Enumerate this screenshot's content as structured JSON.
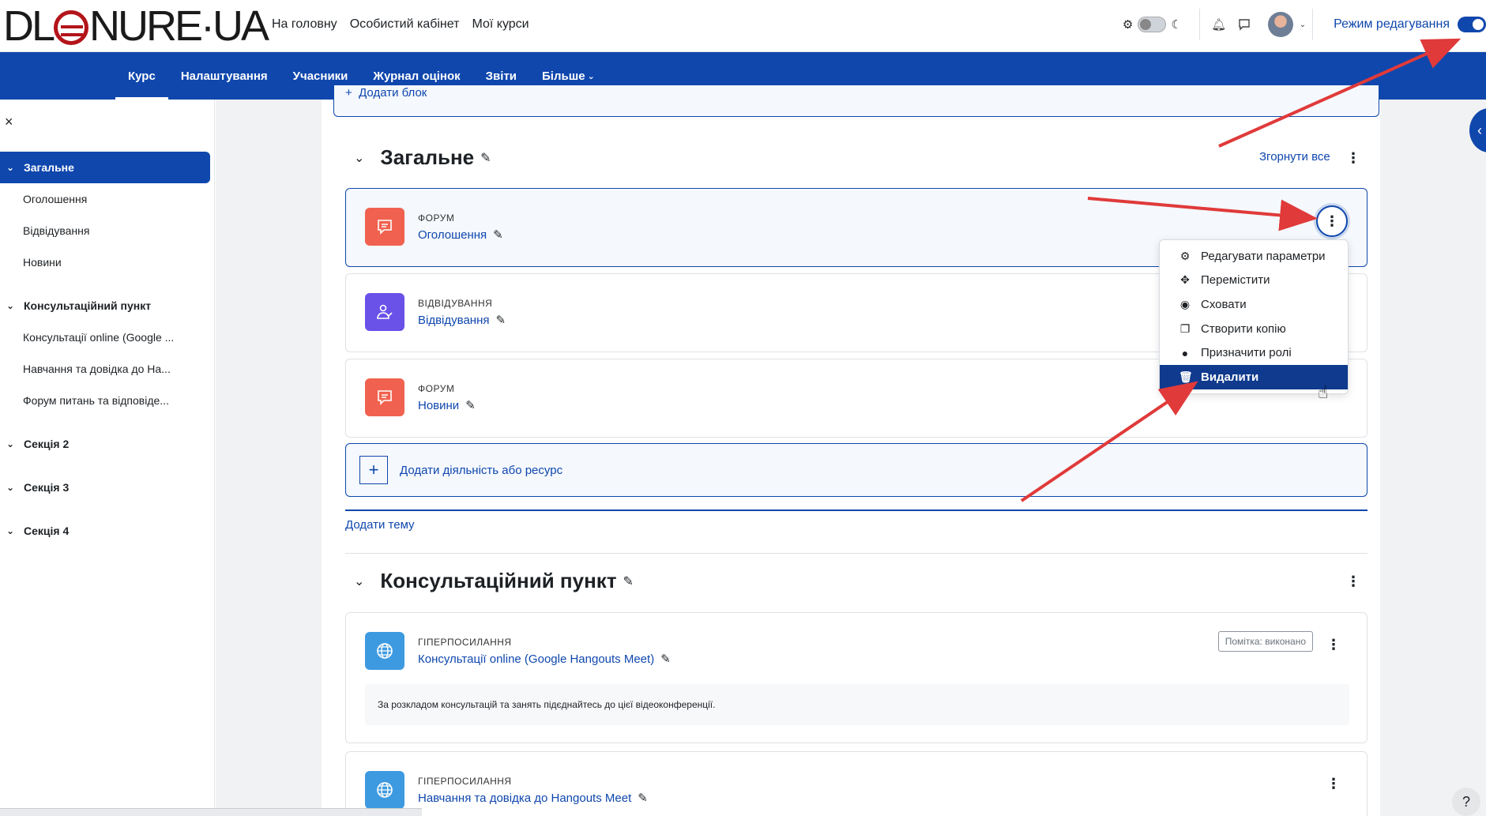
{
  "logo": {
    "text_before": "DL",
    "text_after": "NURE·UA"
  },
  "top_nav": [
    "На головну",
    "Особистий кабінет",
    "Мої курси"
  ],
  "edit_mode_label": "Режим редагування",
  "secondary_nav": {
    "items": [
      "Курс",
      "Налаштування",
      "Учасники",
      "Журнал оцінок",
      "Звіти"
    ],
    "more": "Більше"
  },
  "drawer": {
    "close": "×",
    "sections": [
      {
        "title": "Загальне",
        "items": [
          "Оголошення",
          "Відвідування",
          "Новини"
        ]
      },
      {
        "title": "Консультаційний пункт",
        "items": [
          "Консультації online (Google ...",
          "Навчання та довідка до На...",
          "Форум питань та відповіде..."
        ]
      },
      {
        "title": "Секція 2",
        "items": []
      },
      {
        "title": "Секція 3",
        "items": []
      },
      {
        "title": "Секція 4",
        "items": []
      }
    ]
  },
  "add_block": "Додати блок",
  "section1": {
    "title": "Загальне",
    "collapse_all": "Згорнути все",
    "activities": [
      {
        "type": "ФОРУМ",
        "name": "Оголошення"
      },
      {
        "type": "ВІДВІДУВАННЯ",
        "name": "Відвідування"
      },
      {
        "type": "ФОРУМ",
        "name": "Новини"
      }
    ],
    "add_activity": "Додати діяльність або ресурс",
    "add_topic": "Додати тему"
  },
  "dropdown": {
    "items": [
      {
        "icon": "gear-icon",
        "label": "Редагувати параметри"
      },
      {
        "icon": "move-icon",
        "label": "Перемістити"
      },
      {
        "icon": "eye-icon",
        "label": "Сховати"
      },
      {
        "icon": "copy-icon",
        "label": "Створити копію"
      },
      {
        "icon": "user-circle-icon",
        "label": "Призначити ролі"
      },
      {
        "icon": "trash-icon",
        "label": "Видалити"
      }
    ],
    "active_index": 5
  },
  "section2": {
    "title": "Консультаційний пункт",
    "activities": [
      {
        "type": "ГІПЕРПОСИЛАННЯ",
        "name": "Консультації online (Google Hangouts Meet)",
        "completion": "Помітка: виконано",
        "description": "За розкладом консультацій та занять підєднайтесь до цієї відеоконференції."
      },
      {
        "type": "ГІПЕРПОСИЛАННЯ",
        "name": "Навчання та довідка до Hangouts Meet"
      }
    ]
  },
  "help": "?",
  "colors": {
    "primary": "#0f47ad",
    "forum": "#f0624f",
    "attendance": "#6a51e8",
    "url": "#3e9ae0",
    "arrow": "#e03a3a"
  }
}
